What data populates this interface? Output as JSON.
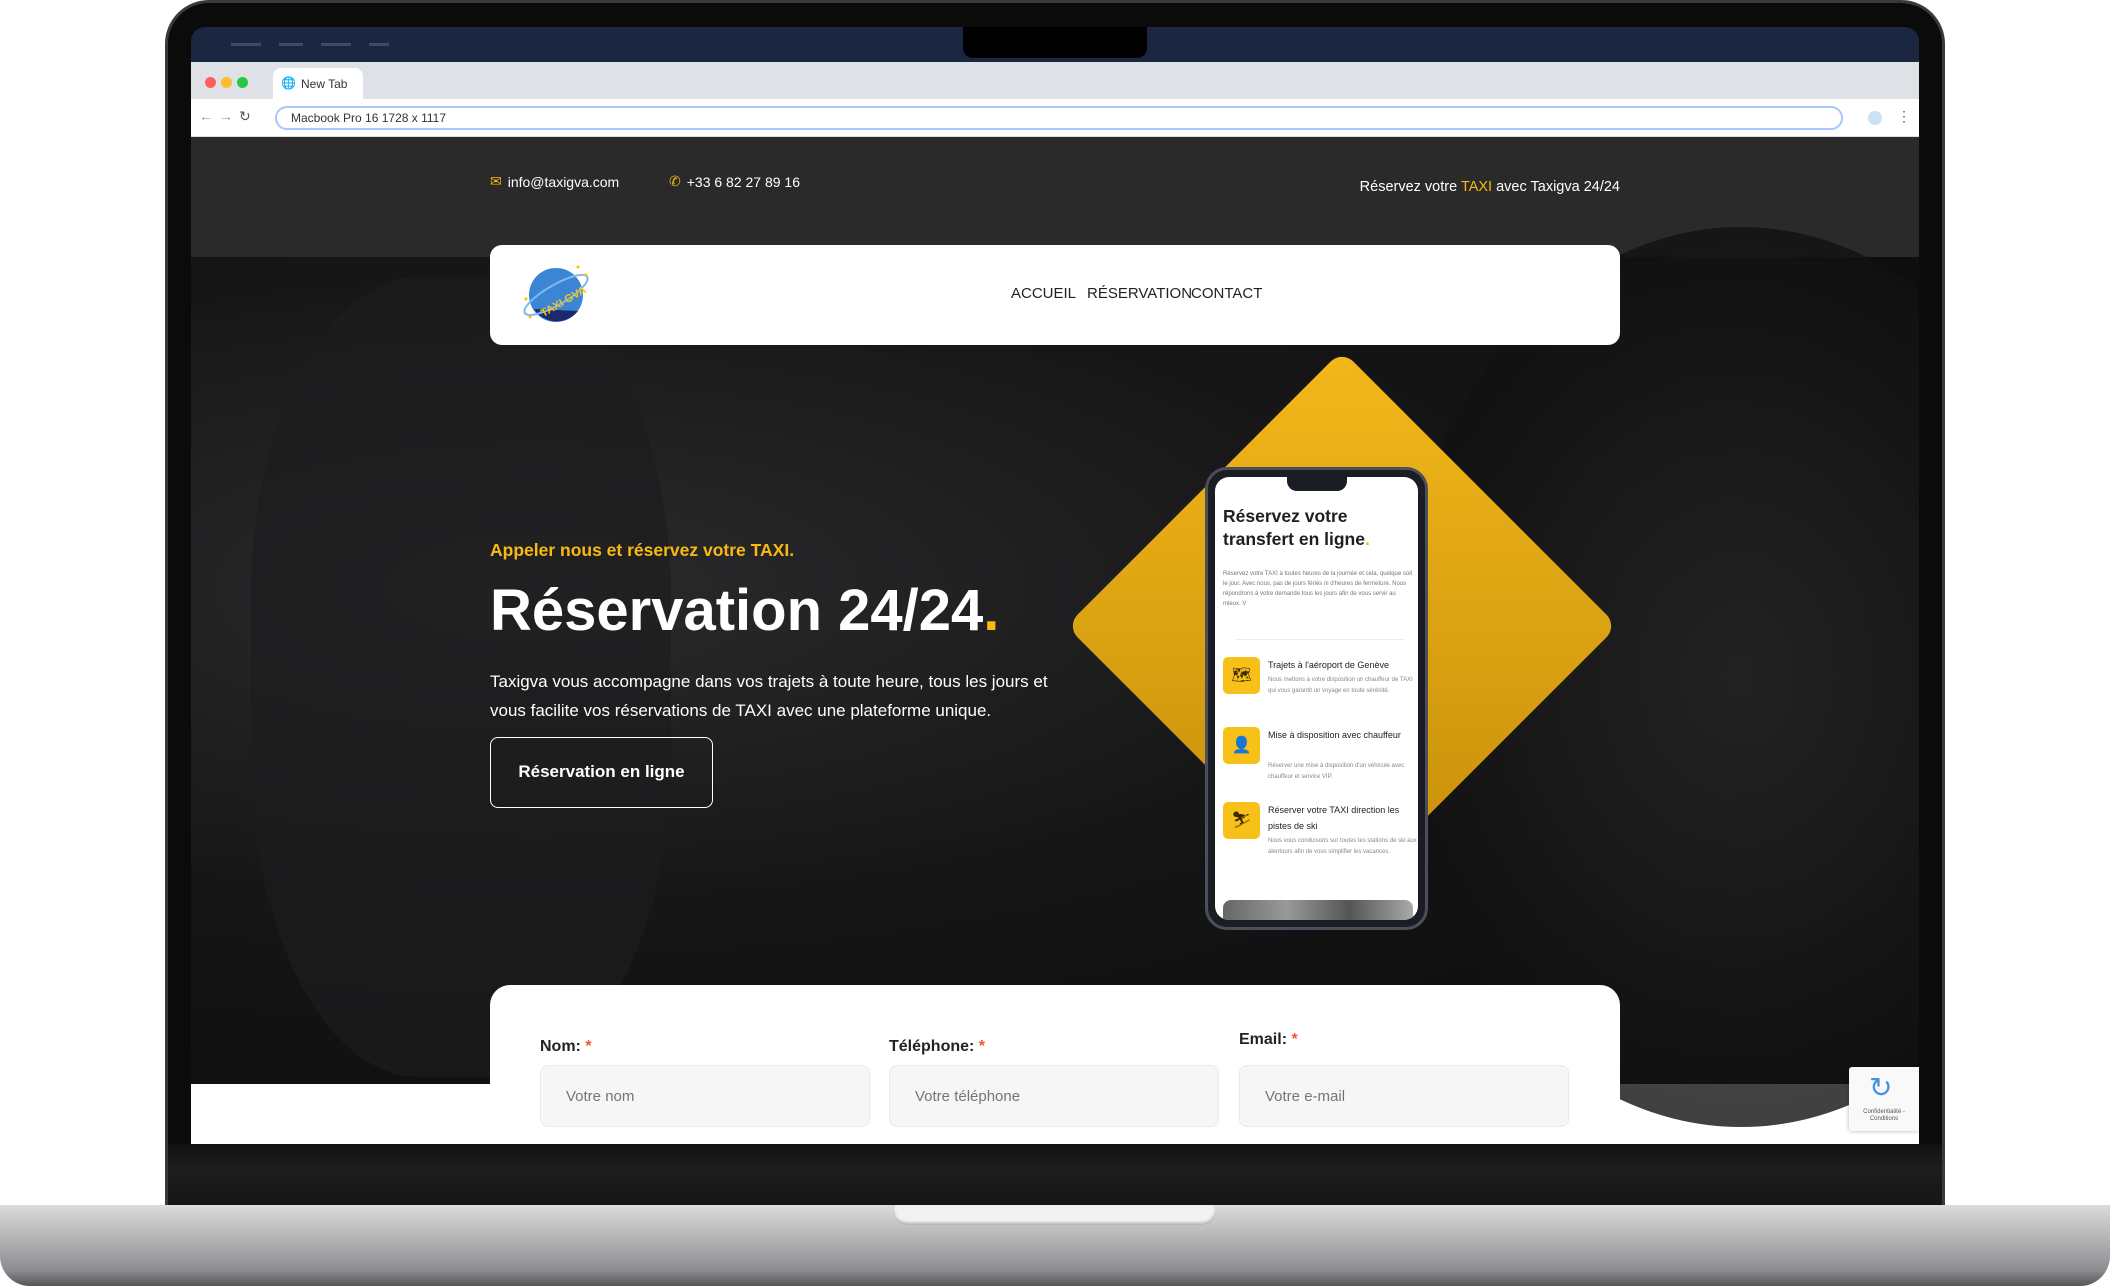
{
  "browser": {
    "tab_title": "New Tab",
    "address": "Macbook Pro 16  1728 x 1117"
  },
  "topbar": {
    "email": "info@taxigva.com",
    "phone": "+33 6 82 27 89 16",
    "tagline_pre": "Réservez votre ",
    "tagline_highlight": "TAXI",
    "tagline_post": " avec Taxigva 24/24"
  },
  "header": {
    "logo_text": "TAXI GVA",
    "nav": [
      {
        "label": "ACCUEIL",
        "active": true
      },
      {
        "label": "RÉSERVATION",
        "active": false
      },
      {
        "label": "CONTACT",
        "active": false
      }
    ]
  },
  "hero": {
    "subtitle": "Appeler nous et réservez votre TAXI.",
    "title": "Réservation 24/24",
    "title_dot": ".",
    "paragraph": "Taxigva vous accompagne dans vos trajets à toute heure, tous les jours et vous facilite vos réservations de TAXI avec une plateforme unique.",
    "cta": "Réservation en ligne"
  },
  "phone": {
    "title": "Réservez votre transfert en ligne",
    "title_dot": ".",
    "desc": "Réservez votre TAXI à toutes heures de la journée et cela, quelque soit le jour. Avec nous, pas de jours fériés ni d'heures de fermeture. Nous répondrons à votre demande tous les jours afin de vous servir au mieux. V",
    "items": [
      {
        "icon": "map-icon",
        "title": "Trajets à l'aéroport de Genève",
        "text": "Nous mettons à votre disposition un chauffeur de TAXI qui vous garantit un voyage en toute sérénité."
      },
      {
        "icon": "chauffeur-icon",
        "title": "Mise à disposition avec chauffeur",
        "text": "Réserver une mise à disposition d'un véhicule avec chauffeur et service VIP."
      },
      {
        "icon": "ski-icon",
        "title": "Réserver votre TAXI direction les pistes de ski",
        "text": "Nous vous conduisons sur toutes les stations de ski aux alentours afin de vous simplifier les vacances."
      }
    ]
  },
  "form": {
    "fields": [
      {
        "label": "Nom:",
        "required": "*",
        "placeholder": "Votre nom"
      },
      {
        "label": "Téléphone:",
        "required": "*",
        "placeholder": "Votre téléphone"
      },
      {
        "label": "Email:",
        "required": "*",
        "placeholder": "Votre e-mail"
      }
    ]
  },
  "recaptcha": {
    "text": "Confidentialité - Conditions"
  },
  "colors": {
    "accent": "#f8b912",
    "menubar": "#1b2640",
    "topbar": "#2a2a2a"
  }
}
